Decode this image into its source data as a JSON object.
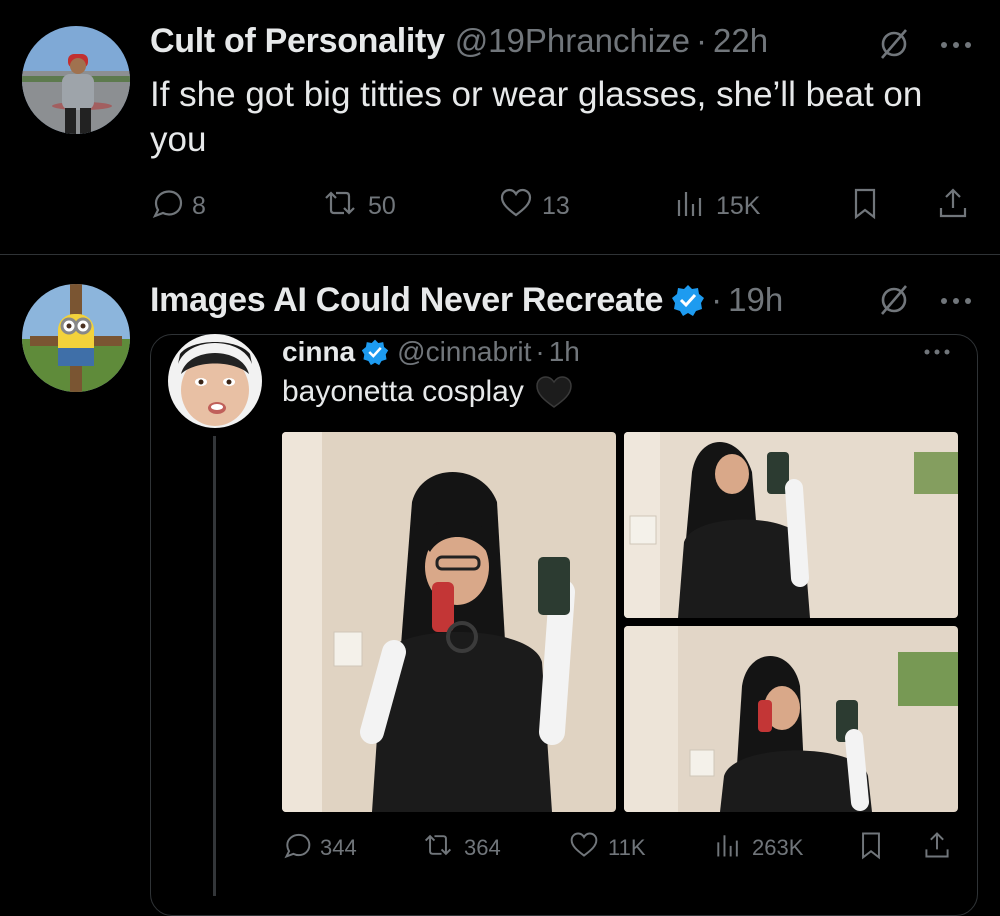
{
  "tweet1": {
    "display_name": "Cult of Personality",
    "handle": "@19Phranchize",
    "time": "22h",
    "separator": "·",
    "text": "If she got big titties or wear glasses, she’ll beat on you",
    "stats": {
      "replies": "8",
      "retweets": "50",
      "likes": "13",
      "views": "15K"
    }
  },
  "tweet2": {
    "display_name": "Images AI Could Never Recreate",
    "time": "19h",
    "separator": "·",
    "verified": true,
    "quoted": {
      "display_name": "cinna",
      "handle": "@cinnabrit",
      "time": "1h",
      "separator": "·",
      "text": "bayonetta cosplay",
      "verified": true,
      "stats": {
        "replies": "344",
        "retweets": "364",
        "likes": "11K",
        "views": "263K"
      }
    }
  },
  "icons": {
    "grok": "grok-icon",
    "more": "more-icon",
    "reply": "reply-icon",
    "retweet": "retweet-icon",
    "like": "heart-icon",
    "views": "views-icon",
    "bookmark": "bookmark-icon",
    "share": "share-icon",
    "verified": "verified-badge-icon",
    "black_heart": "black-heart-emoji-icon"
  },
  "colors": {
    "background": "#000000",
    "text": "#e7e9ea",
    "muted": "#71767b",
    "verified": "#1d9bf0",
    "divider": "#2f3336"
  }
}
